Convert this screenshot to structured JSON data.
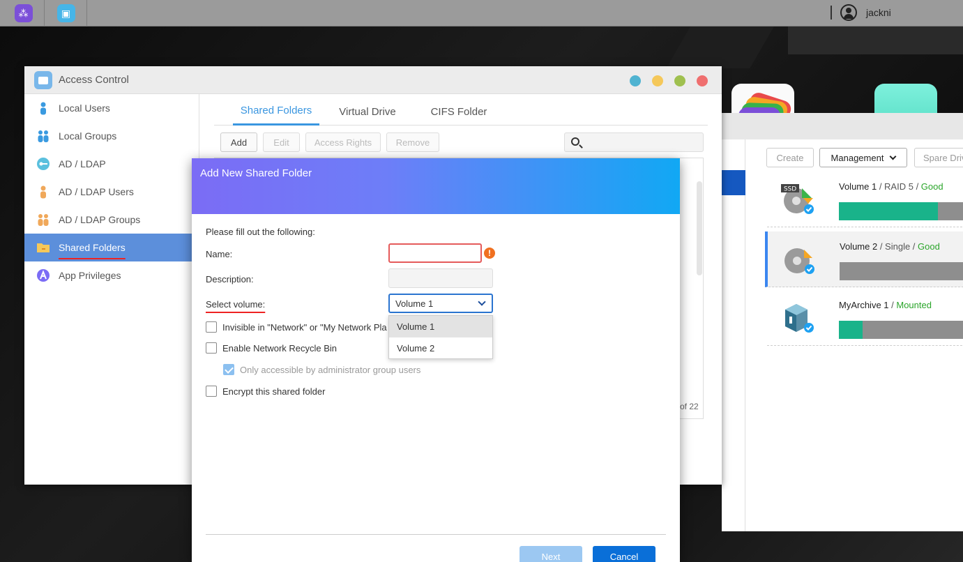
{
  "taskbar": {
    "username": "jackni",
    "app_icons": [
      "launcher-icon",
      "access-control-icon"
    ]
  },
  "access_control": {
    "title": "Access Control",
    "window_dots": [
      "#4fb3d1",
      "#f5c85a",
      "#9fc04f",
      "#ef6f6f"
    ],
    "sidebar": [
      {
        "label": "Local Users",
        "icon": "user-icon",
        "active": false
      },
      {
        "label": "Local Groups",
        "icon": "group-icon",
        "active": false
      },
      {
        "label": "AD / LDAP",
        "icon": "key-icon",
        "active": false
      },
      {
        "label": "AD / LDAP Users",
        "icon": "user-icon",
        "active": false
      },
      {
        "label": "AD / LDAP Groups",
        "icon": "group-icon",
        "active": false
      },
      {
        "label": "Shared Folders",
        "icon": "folder-icon",
        "active": true
      },
      {
        "label": "App Privileges",
        "icon": "app-icon",
        "active": false
      }
    ],
    "tabs": [
      {
        "label": "Shared Folders",
        "active": true
      },
      {
        "label": "Virtual Drive",
        "active": false
      },
      {
        "label": "CIFS Folder",
        "active": false
      }
    ],
    "toolbar": {
      "add": "Add",
      "edit": "Edit",
      "access_rights": "Access Rights",
      "remove": "Remove"
    },
    "pager_text": "of 22"
  },
  "modal": {
    "title": "Add New Shared Folder",
    "intro": "Please fill out the following:",
    "name_label": "Name:",
    "name_value": "",
    "description_label": "Description:",
    "description_value": "",
    "volume_label": "Select volume:",
    "volume_selected": "Volume 1",
    "volume_options": [
      "Volume 1",
      "Volume 2"
    ],
    "checkboxes": {
      "invisible": {
        "label": "Invisible in \"Network\" or \"My Network Pla",
        "checked": false
      },
      "recycle": {
        "label": "Enable Network Recycle Bin",
        "checked": false
      },
      "admin_only": {
        "label": "Only accessible by administrator group users",
        "checked": true
      },
      "encrypt": {
        "label": "Encrypt this shared folder",
        "checked": false
      }
    },
    "buttons": {
      "next": "Next",
      "cancel": "Cancel"
    }
  },
  "storage": {
    "buttons": {
      "create": "Create",
      "management": "Management",
      "spare": "Spare Driv"
    },
    "volumes": [
      {
        "name": "Volume 1",
        "raid": "RAID 5",
        "status": "Good",
        "badge": "SSD",
        "usage": 0.71,
        "selected": false
      },
      {
        "name": "Volume 2",
        "raid": "Single",
        "status": "Good",
        "badge": "",
        "usage": 0.0,
        "selected": true
      },
      {
        "name": "MyArchive 1",
        "raid": "",
        "status": "Mounted",
        "badge": "",
        "usage": 0.17,
        "selected": false
      }
    ]
  },
  "colors": {
    "accent": "#3a96e0",
    "active_sidebar": "#5c8fdb",
    "good": "#2aa52a",
    "usage": "#19b38a",
    "error": "#e55a5a",
    "cancel": "#0a6fd8"
  }
}
